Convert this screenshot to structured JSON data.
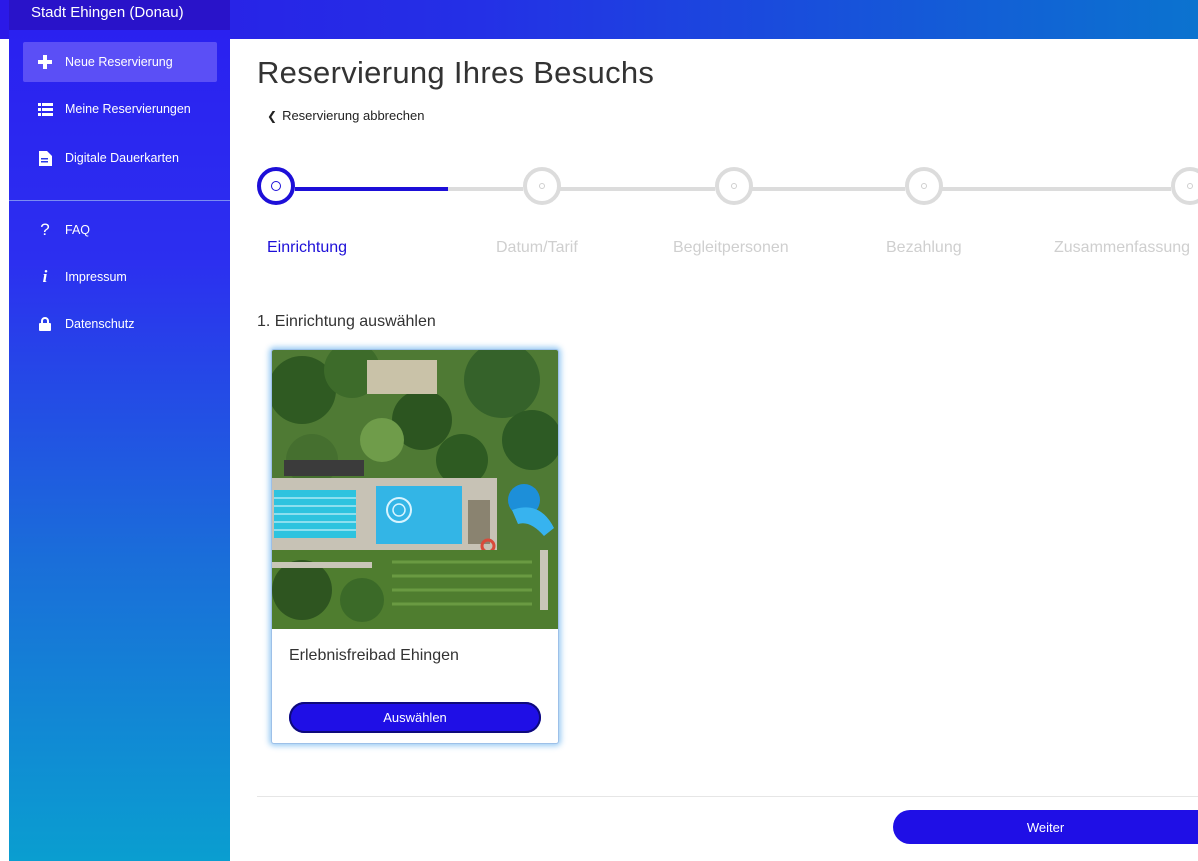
{
  "app": {
    "brand": "Stadt Ehingen (Donau)"
  },
  "sidebar": {
    "items": [
      {
        "label": "Neue Reservierung",
        "icon": "plus-icon",
        "active": true
      },
      {
        "label": "Meine Reservierungen",
        "icon": "list-icon",
        "active": false
      },
      {
        "label": "Digitale Dauerkarten",
        "icon": "document-icon",
        "active": false
      },
      {
        "label": "FAQ",
        "icon": "question-icon",
        "active": false
      },
      {
        "label": "Impressum",
        "icon": "info-icon",
        "active": false
      },
      {
        "label": "Datenschutz",
        "icon": "lock-icon",
        "active": false
      }
    ]
  },
  "page": {
    "title": "Reservierung Ihres Besuchs",
    "back_label": "Reservierung abbrechen",
    "section_title": "1. Einrichtung auswählen"
  },
  "stepper": {
    "steps": [
      {
        "label": "Einrichtung",
        "state": "active"
      },
      {
        "label": "Datum/Tarif",
        "state": "inactive"
      },
      {
        "label": "Begleitpersonen",
        "state": "inactive"
      },
      {
        "label": "Bezahlung",
        "state": "inactive"
      },
      {
        "label": "Zusammenfassung",
        "state": "inactive"
      }
    ]
  },
  "facilities": [
    {
      "name": "Erlebnisfreibad Ehingen",
      "button_label": "Auswählen"
    }
  ],
  "footer": {
    "next_label": "Weiter"
  },
  "colors": {
    "accent": "#1f0fe6",
    "sidebar_top": "#2a1ff0",
    "sidebar_bottom": "#0a9ed0"
  }
}
